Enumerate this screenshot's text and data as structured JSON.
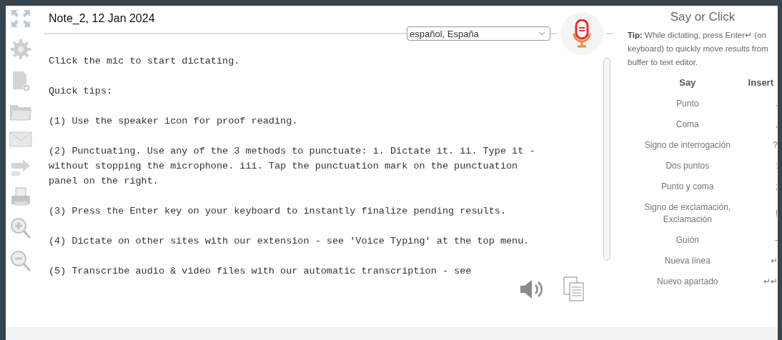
{
  "note_title": "Note_2, 12 Jan 2024",
  "language": {
    "value": "español, España"
  },
  "editor": {
    "paragraphs": [
      "Click the mic to start dictating.",
      "Quick tips:",
      "(1) Use the speaker icon for proof reading.",
      "(2) Punctuating. Use any of the 3 methods to punctuate: i. Dictate it. ii. Type it -\nwithout stopping the microphone. iii. Tap the punctuation mark on the punctuation\npanel on the right.",
      "(3) Press the Enter key on your keyboard to instantly finalize pending results.",
      "(4) Dictate on other sites with our extension - see 'Voice Typing' at the top menu.",
      "(5) Transcribe audio & video files with our automatic transcription - see"
    ]
  },
  "panel": {
    "title": "Say or Click",
    "tip": "**Tip:** While dictating, press Enter↵ (on keyboard) to quickly move results from buffer to text editor.",
    "columns": [
      "Say",
      "Insert"
    ],
    "rows": [
      {
        "say": "Punto",
        "insert": "."
      },
      {
        "say": "Coma",
        "insert": ","
      },
      {
        "say": "Signo de interrogación",
        "insert": "?"
      },
      {
        "say": "Dos puntos",
        "insert": ":"
      },
      {
        "say": "Punto y coma",
        "insert": ";"
      },
      {
        "say": "Signo de exclamación, Exclamación",
        "insert": "!"
      },
      {
        "say": "Guión",
        "insert": "-"
      },
      {
        "say": "Nueva línea",
        "insert": "↵"
      },
      {
        "say": "Nuevo apartado",
        "insert": "↵↵"
      }
    ]
  }
}
